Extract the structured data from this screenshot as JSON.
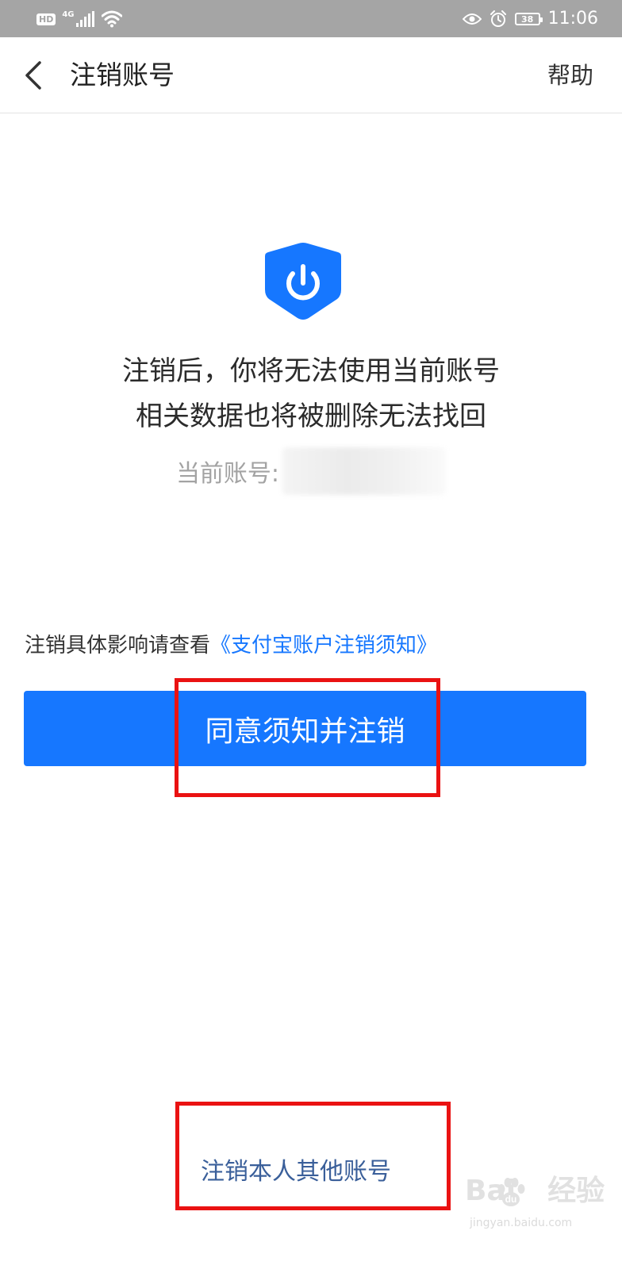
{
  "status_bar": {
    "hd_badge": "HD",
    "network_type": "4G",
    "battery_level": "38",
    "time": "11:06",
    "icons": [
      "signal-icon",
      "wifi-icon",
      "eye-icon",
      "alarm-icon",
      "battery-icon"
    ]
  },
  "nav": {
    "back_icon": "chevron-left-icon",
    "title": "注销账号",
    "help_label": "帮助"
  },
  "content": {
    "shield_icon": "shield-power-icon",
    "message_line1": "注销后，你将无法使用当前账号",
    "message_line2": "相关数据也将被删除无法找回",
    "account_label": "当前账号:",
    "notice_text": "注销具体影响请查看",
    "notice_link": "《支付宝账户注销须知》",
    "primary_button": "同意须知并注销",
    "other_accounts_link": "注销本人其他账号"
  },
  "watermark": {
    "brand": "Bai",
    "brand_suffix": "经验",
    "domain": "jingyan.baidu.com"
  },
  "colors": {
    "status_bar_bg": "#a5a5a5",
    "accent": "#1677ff",
    "link_dark": "#3a5f9a",
    "highlight_red": "#ea1212"
  }
}
